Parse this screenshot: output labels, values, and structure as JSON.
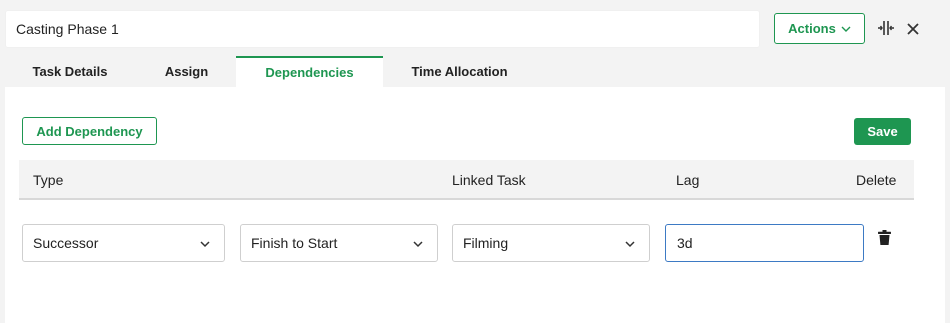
{
  "header": {
    "title_value": "Casting Phase 1",
    "actions_label": "Actions",
    "actions_icon": "chevron-down-icon",
    "split_icon": "split-view-icon",
    "close_icon": "close-icon"
  },
  "tabs": [
    {
      "label": "Task Details",
      "active": false
    },
    {
      "label": "Assign",
      "active": false
    },
    {
      "label": "Dependencies",
      "active": true
    },
    {
      "label": "Time Allocation",
      "active": false
    }
  ],
  "toolbar": {
    "add_dependency_label": "Add Dependency",
    "save_label": "Save"
  },
  "table": {
    "columns": [
      "Type",
      "Linked Task",
      "Lag",
      "Delete"
    ],
    "rows": [
      {
        "type": "Successor",
        "relation": "Finish to Start",
        "linked_task": "Filming",
        "lag": "3d",
        "delete_icon": "trash-icon"
      }
    ]
  },
  "colors": {
    "accent": "#1e9651",
    "focus_border": "#3d7ac4",
    "header_bg": "#f3f3f3"
  }
}
